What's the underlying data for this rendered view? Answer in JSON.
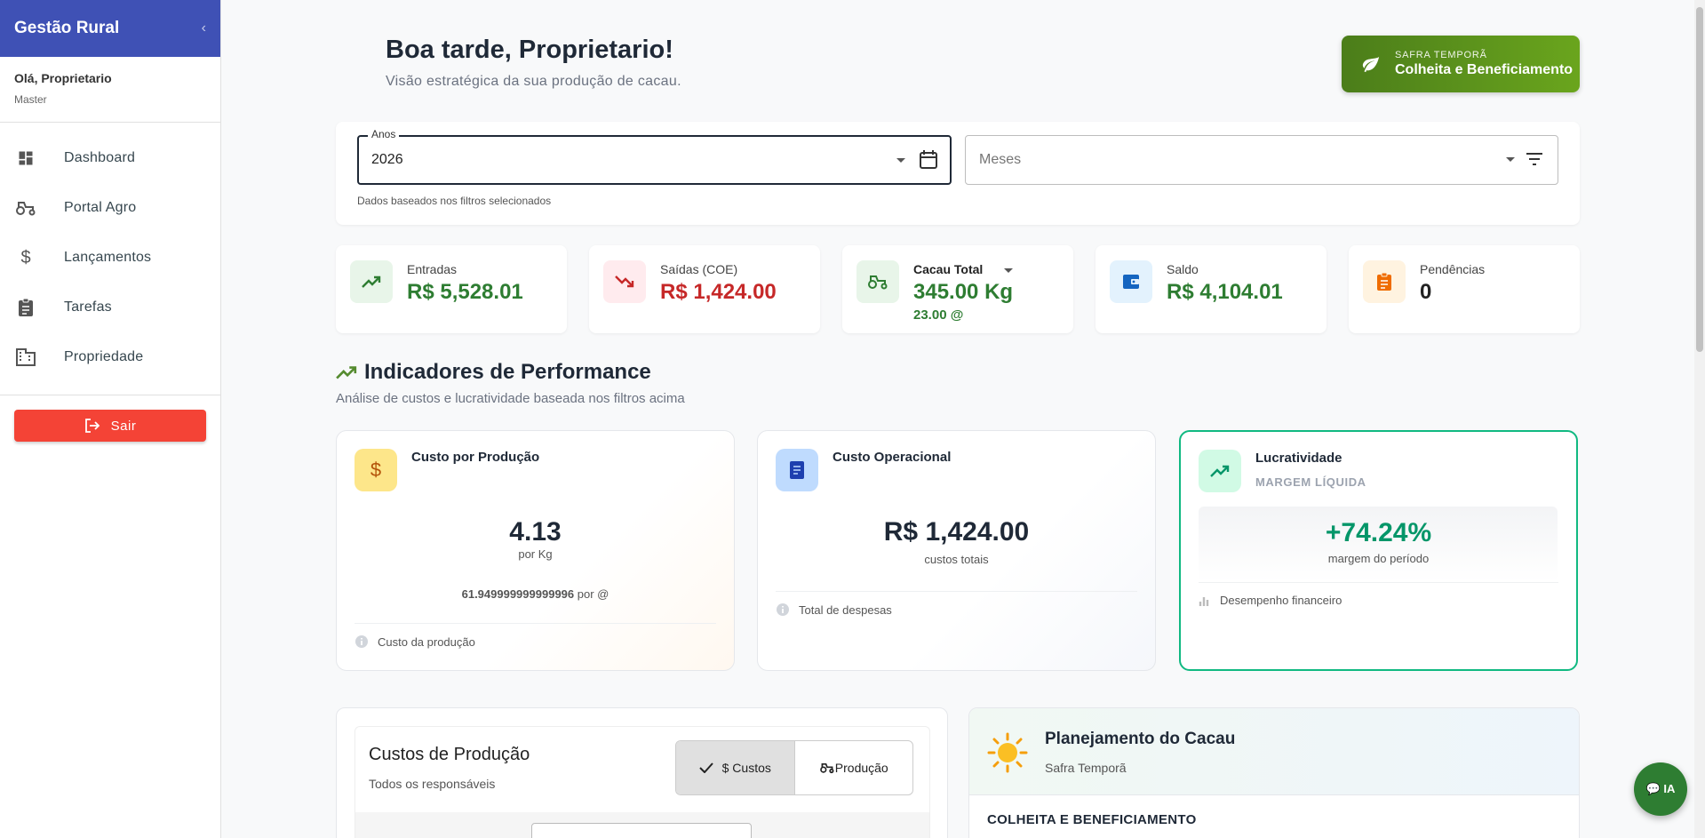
{
  "sidebar": {
    "title": "Gestão Rural",
    "collapse_icon": "‹",
    "user_greeting": "Olá, Proprietario",
    "user_role": "Master",
    "items": [
      {
        "label": "Dashboard",
        "icon": "dashboard-icon"
      },
      {
        "label": "Portal Agro",
        "icon": "tractor-icon"
      },
      {
        "label": "Lançamentos",
        "icon": "dollar-icon"
      },
      {
        "label": "Tarefas",
        "icon": "clipboard-icon"
      },
      {
        "label": "Propriedade",
        "icon": "building-icon"
      }
    ],
    "logout_label": "Sair"
  },
  "header": {
    "greeting": "Boa tarde, Proprietario!",
    "subtitle": "Visão estratégica da sua produção de cacau.",
    "season_label": "SAFRA TEMPORÃ",
    "season_name": "Colheita e Beneficiamento"
  },
  "filters": {
    "years_label": "Anos",
    "years_value": "2026",
    "months_placeholder": "Meses",
    "hint": "Dados baseados nos filtros selecionados"
  },
  "kpis": {
    "entradas": {
      "label": "Entradas",
      "value": "R$ 5,528.01"
    },
    "saidas": {
      "label": "Saídas (COE)",
      "value": "R$ 1,424.00"
    },
    "cacau": {
      "label": "Cacau Total",
      "value": "345.00 Kg",
      "sub": "23.00 @"
    },
    "saldo": {
      "label": "Saldo",
      "value": "R$ 4,104.01"
    },
    "pendencias": {
      "label": "Pendências",
      "value": "0"
    }
  },
  "performance": {
    "title": "Indicadores de Performance",
    "subtitle": "Análise de custos e lucratividade baseada nos filtros acima",
    "cost_per_production": {
      "title": "Custo por Produção",
      "value": "4.13",
      "unit": "por Kg",
      "per_arroba_value": "61.949999999999996",
      "per_arroba_unit": "por @",
      "footer": "Custo da produção"
    },
    "operational_cost": {
      "title": "Custo Operacional",
      "value": "R$ 1,424.00",
      "unit": "custos totais",
      "footer": "Total de despesas"
    },
    "profitability": {
      "title": "Lucratividade",
      "subtitle": "MARGEM LÍQUIDA",
      "value": "+74.24%",
      "unit": "margem do período",
      "footer": "Desempenho financeiro"
    }
  },
  "production_costs": {
    "title": "Custos de Produção",
    "subtitle": "Todos os responsáveis",
    "toggle_costs": "$ Custos",
    "toggle_production": "Produção"
  },
  "planning": {
    "title": "Planejamento do Cacau",
    "subtitle": "Safra Temporã",
    "stage": "COLHEITA E BENEFICIAMENTO"
  },
  "ia_button": "💬 IA",
  "colors": {
    "sidebar_header": "#3f51b5",
    "logout": "#f44336",
    "income": "#2e7d32",
    "expense": "#c62828",
    "profit": "#059669",
    "season_gradient_start": "#4b7d1a",
    "season_gradient_end": "#6aa51d"
  }
}
